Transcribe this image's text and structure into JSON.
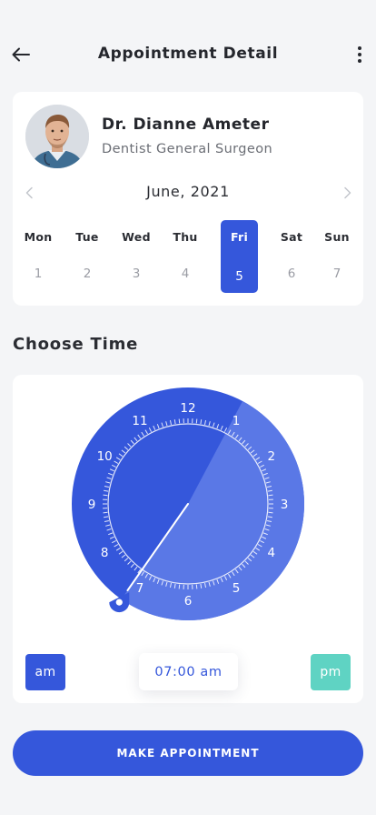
{
  "header": {
    "title": "Appointment Detail",
    "back_icon": "arrow-left-icon",
    "more_icon": "more-vertical-icon"
  },
  "doctor": {
    "name": "Dr. Dianne Ameter",
    "role": "Dentist General Surgeon",
    "avatar_icon": "doctor-avatar"
  },
  "calendar": {
    "month": "June, 2021",
    "prev_icon": "chevron-left-icon",
    "next_icon": "chevron-right-icon",
    "days": [
      {
        "name": "Mon",
        "num": "1",
        "selected": false
      },
      {
        "name": "Tue",
        "num": "2",
        "selected": false
      },
      {
        "name": "Wed",
        "num": "3",
        "selected": false
      },
      {
        "name": "Thu",
        "num": "4",
        "selected": false
      },
      {
        "name": "Fri",
        "num": "5",
        "selected": true
      },
      {
        "name": "Sat",
        "num": "6",
        "selected": false
      },
      {
        "name": "Sun",
        "num": "7",
        "selected": false
      }
    ]
  },
  "time_section": {
    "title": "Choose Time",
    "clock_numbers": [
      "12",
      "1",
      "2",
      "3",
      "4",
      "5",
      "6",
      "7",
      "8",
      "9",
      "10",
      "11"
    ],
    "selected_hour": 7,
    "am_label": "am",
    "pm_label": "pm",
    "time_value": "07:00 am"
  },
  "actions": {
    "make_appointment": "MAKE APPOINTMENT"
  },
  "colors": {
    "primary": "#3557db",
    "primary_light": "#5a78e6",
    "accent": "#5fd3c3",
    "background": "#f4f5f7"
  }
}
